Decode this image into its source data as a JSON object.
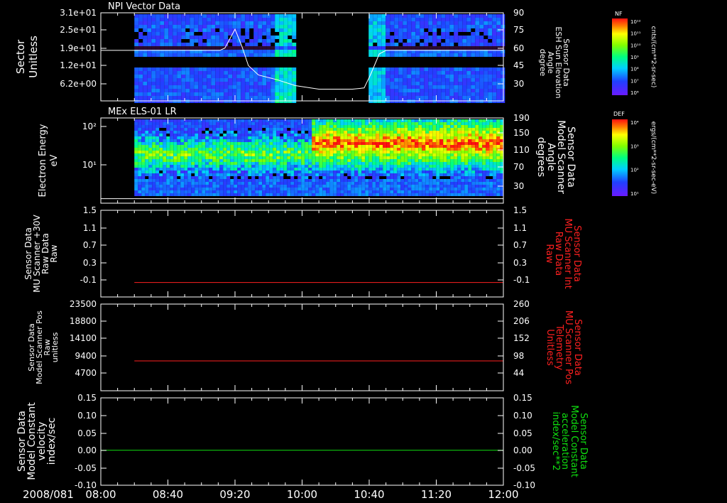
{
  "colors": {
    "background": "#000000",
    "axis": "#ffffff",
    "red_trace": "#ff2020",
    "green_trace": "#10e010",
    "white_trace": "#ffffff"
  },
  "time_axis": {
    "date_label": "2008/081",
    "ticks": [
      "08:00",
      "08:40",
      "09:20",
      "10:00",
      "10:40",
      "11:20",
      "12:00"
    ]
  },
  "colorbars": [
    {
      "title": "NF",
      "tick_labels": [
        "10¹²",
        "10¹¹",
        "10¹⁰",
        "10⁹",
        "10⁸",
        "10⁷",
        "10⁶"
      ],
      "unit": "cnts/(cm**2-sr-sec)"
    },
    {
      "title": "DEF",
      "tick_labels": [
        "10⁴",
        "10³",
        "10²",
        "10¹"
      ],
      "unit": "ergs/(cm**2-sr-sec-eV)"
    }
  ],
  "chart_data": [
    {
      "type": "heatmap",
      "title": "NPI Vector Data",
      "ylabel_left": [
        "Sector",
        "Unitless"
      ],
      "ylabel_right": [
        "Sensor Data",
        "ESH Sun Elevation",
        "Angle",
        "degree"
      ],
      "left_tick_labels": [
        "3.1e+01",
        "2.5e+01",
        "1.9e+01",
        "1.2e+01",
        "6.2e+00"
      ],
      "right_tick_labels": [
        "90",
        "75",
        "60",
        "45",
        "30"
      ],
      "right_ylim": [
        15,
        90
      ],
      "data_gap": {
        "from": "09:56",
        "to": "10:39"
      },
      "line_series": {
        "name": "ESH Sun Elevation Angle",
        "x": [
          "08:00",
          "09:11",
          "09:14",
          "09:17",
          "09:20",
          "09:24",
          "09:28",
          "09:34",
          "09:45",
          "09:56",
          "10:10",
          "10:30",
          "10:37",
          "10:41",
          "10:46",
          "10:50",
          "12:00"
        ],
        "y": [
          58,
          58,
          60,
          68,
          76,
          62,
          45,
          37,
          33,
          28,
          25,
          25,
          26,
          38,
          55,
          58,
          58
        ]
      }
    },
    {
      "type": "heatmap",
      "title": "MEx ELS-01 LR",
      "ylabel_left": [
        "Electron Energy",
        "eV"
      ],
      "ylabel_right": [
        "Sensor Data",
        "Model Scanner",
        "Angle",
        "degrees"
      ],
      "left_tick_labels": [
        "10²",
        "10¹"
      ],
      "right_tick_labels": [
        "190",
        "150",
        "110",
        "70",
        "30"
      ],
      "right_ylim": [
        0,
        190
      ],
      "line_series": {
        "name": "Model Scanner Angle",
        "x": [
          "08:00",
          "12:00"
        ],
        "y": [
          10,
          10
        ]
      }
    },
    {
      "type": "line",
      "ylabel_left": [
        "Sensor Data",
        "MU Scanner +30V",
        "Raw Data",
        "Raw"
      ],
      "ylabel_right": [
        "Sensor Data",
        "MU Scanner Int",
        "Raw Data",
        "Raw"
      ],
      "left_tick_labels": [
        "1.5",
        "1.1",
        "0.7",
        "0.3",
        "-0.1"
      ],
      "right_tick_labels": [
        "1.5",
        "1.1",
        "0.7",
        "0.3",
        "-0.1"
      ],
      "ylim": [
        -0.3,
        1.5
      ],
      "series": [
        {
          "x": [
            "08:20",
            "12:00"
          ],
          "y": [
            0.0,
            0.0
          ]
        }
      ]
    },
    {
      "type": "line",
      "ylabel_left": [
        "Sensor Data",
        "Model Scanner Pos",
        "Raw",
        "unitless"
      ],
      "ylabel_right": [
        "Sensor Data",
        "MU Scanner Pos",
        "Telemetry",
        "Unitless"
      ],
      "left_tick_labels": [
        "23500",
        "18800",
        "14100",
        "9400",
        "4700"
      ],
      "right_tick_labels": [
        "260",
        "206",
        "152",
        "98",
        "44"
      ],
      "ylim": [
        0,
        23500
      ],
      "series": [
        {
          "x": [
            "08:20",
            "12:00"
          ],
          "y": [
            8100,
            8100
          ]
        }
      ]
    },
    {
      "type": "line",
      "ylabel_left": [
        "Sensor Data",
        "Model Constant",
        "velocity",
        "index/sec"
      ],
      "ylabel_right": [
        "Sensor Data",
        "Model Constant",
        "acceleration",
        "index/sec**2"
      ],
      "left_tick_labels": [
        "0.15",
        "0.10",
        "0.05",
        "0.00",
        "-0.05",
        "-0.10"
      ],
      "right_tick_labels": [
        "0.15",
        "0.10",
        "0.05",
        "0.00",
        "-0.05",
        "-0.10"
      ],
      "ylim": [
        -0.1,
        0.15
      ],
      "series": [
        {
          "x": [
            "08:00",
            "12:00"
          ],
          "y": [
            0.0,
            0.0
          ]
        }
      ]
    }
  ]
}
